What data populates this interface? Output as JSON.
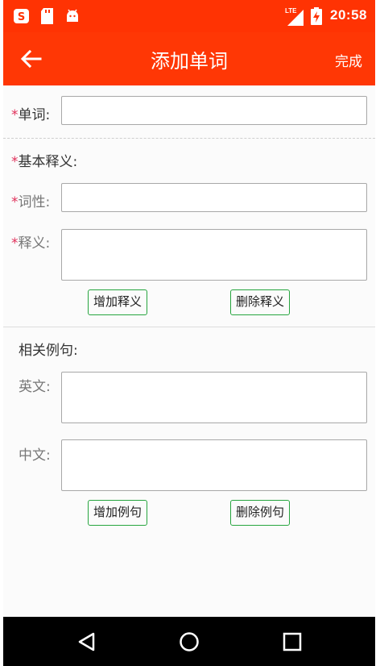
{
  "status_bar": {
    "time": "20:58",
    "network": "LTE",
    "icons": [
      "app-notification-icon",
      "sd-card-icon",
      "android-icon",
      "lte-signal-icon",
      "battery-charging-icon"
    ]
  },
  "app_bar": {
    "title": "添加单词",
    "done_label": "完成",
    "back_icon": "arrow-left-icon"
  },
  "form": {
    "word": {
      "required_mark": "*",
      "label": "单词:",
      "value": ""
    },
    "basic_meaning": {
      "required_mark": "*",
      "label": "基本释义:"
    },
    "part_of_speech": {
      "required_mark": "*",
      "label": "词性:",
      "value": ""
    },
    "definition": {
      "required_mark": "*",
      "label": "释义:",
      "value": ""
    },
    "add_definition_label": "增加释义",
    "delete_definition_label": "删除释义",
    "examples": {
      "label": "相关例句:"
    },
    "english": {
      "label": "英文:",
      "value": ""
    },
    "chinese": {
      "label": "中文:",
      "value": ""
    },
    "add_example_label": "增加例句",
    "delete_example_label": "删除例句"
  },
  "nav_bar": {
    "items": [
      "back-triangle-icon",
      "home-circle-icon",
      "recents-square-icon"
    ]
  },
  "colors": {
    "accent": "#ff3705",
    "required": "#e0305a",
    "button_border": "#27a53f"
  }
}
